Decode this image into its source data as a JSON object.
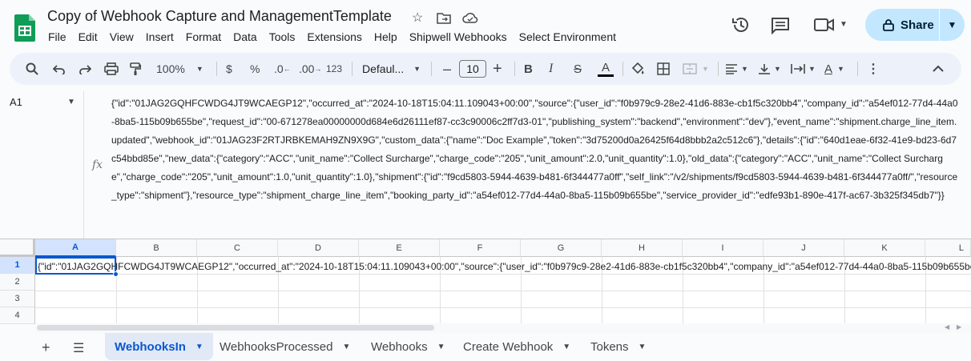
{
  "app": {
    "doc_title": "Copy of Webhook Capture and ManagementTemplate",
    "icons": {
      "logo": "google-sheets-logo",
      "star": "star-icon",
      "move": "move-folder-icon",
      "cloud": "cloud-saved-icon"
    }
  },
  "menu": [
    "File",
    "Edit",
    "View",
    "Insert",
    "Format",
    "Data",
    "Tools",
    "Extensions",
    "Help",
    "Shipwell Webhooks",
    "Select Environment"
  ],
  "header_actions": {
    "share_label": "Share",
    "icons": [
      "history-icon",
      "comment-icon",
      "meet-icon"
    ]
  },
  "toolbar": {
    "zoom": "100%",
    "currency": "$",
    "percent": "%",
    "dec_decrease": ".0",
    "dec_increase": ".00",
    "number_format": "123",
    "font": "Defaul...",
    "font_size": "10",
    "minus": "–",
    "plus": "+",
    "bold": "B",
    "italic": "I",
    "strike": "S",
    "text_color": "A",
    "text_rotate": "A"
  },
  "formula_bar": {
    "cell_ref": "A1",
    "fx": "fx",
    "content": "{\"id\":\"01JAG2GQHFCWDG4JT9WCAEGP12\",\"occurred_at\":\"2024-10-18T15:04:11.109043+00:00\",\"source\":{\"user_id\":\"f0b979c9-28e2-41d6-883e-cb1f5c320bb4\",\"company_id\":\"a54ef012-77d4-44a0-8ba5-115b09b655be\",\"request_id\":\"00-671278ea00000000d684e6d26111ef87-cc3c90006c2ff7d3-01\",\"publishing_system\":\"backend\",\"environment\":\"dev\"},\"event_name\":\"shipment.charge_line_item.updated\",\"webhook_id\":\"01JAG23F2RTJRBKEMAH9ZN9X9G\",\"custom_data\":{\"name\":\"Doc Example\",\"token\":\"3d75200d0a26425f64d8bbb2a2c512c6\"},\"details\":{\"id\":\"640d1eae-6f32-41e9-bd23-6d7c54bbd85e\",\"new_data\":{\"category\":\"ACC\",\"unit_name\":\"Collect Surcharge\",\"charge_code\":\"205\",\"unit_amount\":2.0,\"unit_quantity\":1.0},\"old_data\":{\"category\":\"ACC\",\"unit_name\":\"Collect Surcharge\",\"charge_code\":\"205\",\"unit_amount\":1.0,\"unit_quantity\":1.0},\"shipment\":{\"id\":\"f9cd5803-5944-4639-b481-6f344477a0ff\",\"self_link\":\"/v2/shipments/f9cd5803-5944-4639-b481-6f344477a0ff/\",\"resource_type\":\"shipment\"},\"resource_type\":\"shipment_charge_line_item\",\"booking_party_id\":\"a54ef012-77d4-44a0-8ba5-115b09b655be\",\"service_provider_id\":\"edfe93b1-890e-417f-ac67-3b325f345db7\"}}"
  },
  "grid": {
    "columns": [
      "A",
      "B",
      "C",
      "D",
      "E",
      "F",
      "G",
      "H",
      "I",
      "J",
      "K",
      "L"
    ],
    "rows": [
      "1",
      "2",
      "3",
      "4"
    ],
    "selected_cell": "A1",
    "a1_display": "{\"id\":\"01JAG2GQHFCWDG4JT9WCAEGP12\",\"occurred_at\":\"2024-10-18T15:04:11.109043+00:00\",\"source\":{\"user_id\":\"f0b979c9-28e2-41d6-883e-cb1f5c320bb4\",\"company_id\":\"a54ef012-77d4-44a0-8ba5-115b09b655be\""
  },
  "sheets": [
    {
      "name": "WebhooksIn",
      "active": true
    },
    {
      "name": "WebhooksProcessed",
      "active": false
    },
    {
      "name": "Webhooks",
      "active": false
    },
    {
      "name": "Create Webhook",
      "active": false
    },
    {
      "name": "Tokens",
      "active": false
    }
  ]
}
